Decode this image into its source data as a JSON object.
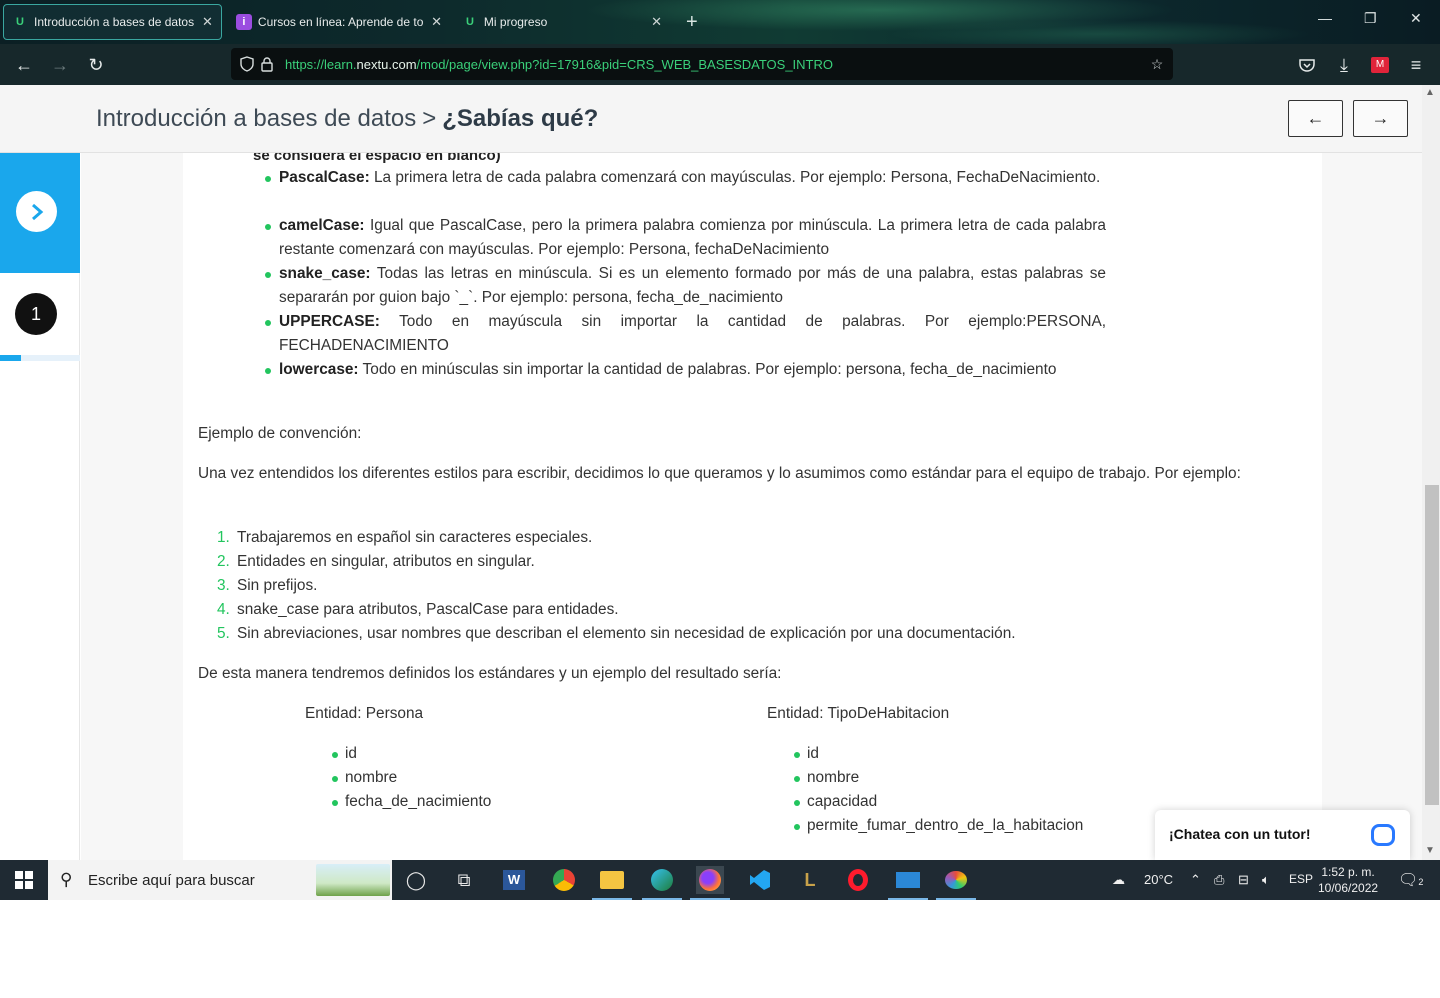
{
  "browser": {
    "tabs": [
      {
        "label": "Introducción a bases de datos: ¿",
        "icon": "u-logo-icon",
        "active": true
      },
      {
        "label": "Cursos en línea: Aprende de tod",
        "icon": "pin-icon",
        "active": false
      },
      {
        "label": "Mi progreso",
        "icon": "u-logo-icon",
        "active": false
      }
    ],
    "url_prefix": "https://learn.",
    "url_domain": "nextu.com",
    "url_path": "/mod/page/view.php?id=17916&pid=CRS_WEB_BASESDATOS_INTRO"
  },
  "header": {
    "course": "Introducción a bases de datos",
    "separator": ">",
    "current": "¿Sabías qué?",
    "prev_label": "←",
    "next_label": "→"
  },
  "rail": {
    "expand_icon": "chevron-right-icon",
    "step_number": "1",
    "progress_fraction": 0.26
  },
  "content": {
    "clipped_line": "se considera el espacio en blanco)",
    "styles": [
      {
        "name": "PascalCase:",
        "text": " La primera letra de cada palabra comenzará con mayúsculas. Por ejemplo: Persona, FechaDeNacimiento."
      },
      {
        "name": "camelCase:",
        "text": " Igual que PascalCase, pero la primera palabra comienza por minúscula. La primera letra de cada palabra restante comenzará con mayúsculas. Por ejemplo: Persona, fechaDeNacimiento"
      },
      {
        "name": "snake_case:",
        "text": " Todas las letras en minúscula. Si es un elemento formado por más de una palabra, estas palabras se separarán por guion bajo `_`. Por ejemplo: persona, fecha_de_nacimiento"
      },
      {
        "name": "UPPERCASE:",
        "text": " Todo en mayúscula sin importar la cantidad de palabras. Por ejemplo:PERSONA, FECHADENACIMIENTO"
      },
      {
        "name": "lowercase:",
        "text": " Todo en minúsculas sin importar la cantidad de palabras. Por ejemplo: persona, fecha_de_nacimiento"
      }
    ],
    "example_heading": "Ejemplo de convención:",
    "intro_paragraph": "Una vez entendidos los diferentes estilos para escribir, decidimos lo que queramos y lo asumimos como estándar para el equipo de trabajo. Por ejemplo:",
    "rules": [
      {
        "n": "1.",
        "text": "Trabajaremos en español sin caracteres especiales."
      },
      {
        "n": "2.",
        "text": "Entidades en singular, atributos en singular."
      },
      {
        "n": "3.",
        "text": "Sin prefijos."
      },
      {
        "n": "4.",
        "text": "snake_case para atributos, PascalCase para entidades."
      },
      {
        "n": "5.",
        "text": "Sin abreviaciones, usar nombres que describan el elemento sin necesidad de explicación por una documentación."
      }
    ],
    "result_paragraph": "De esta manera tendremos definidos los estándares y un ejemplo del resultado sería:",
    "entities": [
      {
        "title": "Entidad: Persona",
        "attributes": [
          "id",
          "nombre",
          "fecha_de_nacimiento"
        ]
      },
      {
        "title": "Entidad: TipoDeHabitacion",
        "attributes": [
          "id",
          "nombre",
          "capacidad",
          "permite_fumar_dentro_de_la_habitacion"
        ]
      }
    ]
  },
  "chat": {
    "label": "¡Chatea con un tutor!"
  },
  "taskbar": {
    "search_placeholder": "Escribe aquí para buscar",
    "temperature": "20°C",
    "language": "ESP",
    "time": "1:52 p. m.",
    "date": "10/06/2022",
    "notifications": "2"
  },
  "colors": {
    "accent_blue": "#1aa7ec",
    "bullet_green": "#22c55e",
    "url_green": "#3ad07a",
    "chat_blue": "#2979ff"
  }
}
